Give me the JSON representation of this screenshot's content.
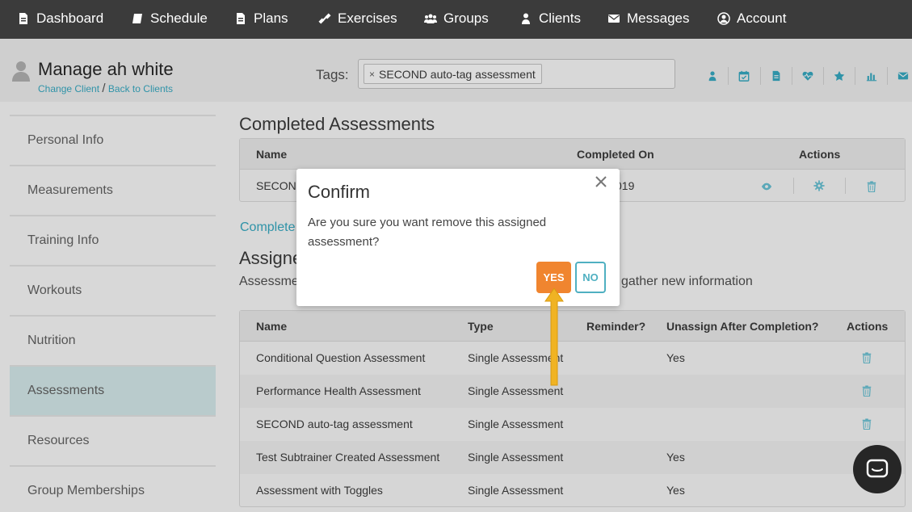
{
  "nav": [
    {
      "label": "Dashboard",
      "icon": "file-icon"
    },
    {
      "label": "Schedule",
      "icon": "book-icon"
    },
    {
      "label": "Plans",
      "icon": "document-icon"
    },
    {
      "label": "Exercises",
      "icon": "dumbbell-icon"
    },
    {
      "label": "Groups",
      "icon": "users-icon"
    },
    {
      "label": "Clients",
      "icon": "user-icon"
    },
    {
      "label": "Messages",
      "icon": "envelope-icon"
    },
    {
      "label": "Account",
      "icon": "account-circle-icon"
    }
  ],
  "header": {
    "title": "Manage ah white",
    "change_client": "Change Client",
    "separator": "/",
    "back_to_clients": "Back to Clients",
    "tags_label": "Tags:",
    "tags": [
      "SECOND auto-tag assessment"
    ],
    "quick_icons": [
      "user-icon",
      "calendar-icon",
      "document-icon",
      "heartbeat-icon",
      "star-icon",
      "bar-chart-icon",
      "envelope-icon"
    ]
  },
  "sidebar": {
    "items": [
      {
        "label": "Personal Info"
      },
      {
        "label": "Measurements"
      },
      {
        "label": "Training Info"
      },
      {
        "label": "Workouts"
      },
      {
        "label": "Nutrition"
      },
      {
        "label": "Assessments",
        "active": true
      },
      {
        "label": "Resources"
      },
      {
        "label": "Group Memberships"
      }
    ]
  },
  "completed": {
    "title": "Completed Assessments",
    "headers": {
      "name": "Name",
      "completed_on": "Completed On",
      "actions": "Actions"
    },
    "row": {
      "name": "SECOND",
      "completed_on": "019"
    },
    "complete_link": "Complete"
  },
  "assigned": {
    "title": "Assigne",
    "desc_left": "Assessme",
    "desc_right": "gather new information",
    "headers": {
      "name": "Name",
      "type": "Type",
      "reminder": "Reminder?",
      "unassign": "Unassign After Completion?",
      "actions": "Actions"
    },
    "rows": [
      {
        "name": "Conditional Question Assessment",
        "type": "Single Assessment",
        "reminder": "",
        "unassign": "Yes"
      },
      {
        "name": "Performance Health Assessment",
        "type": "Single Assessment",
        "reminder": "",
        "unassign": ""
      },
      {
        "name": "SECOND auto-tag assessment",
        "type": "Single Assessment",
        "reminder": "",
        "unassign": ""
      },
      {
        "name": "Test Subtrainer Created Assessment",
        "type": "Single Assessment",
        "reminder": "",
        "unassign": "Yes"
      },
      {
        "name": "Assessment with Toggles",
        "type": "Single Assessment",
        "reminder": "",
        "unassign": "Yes"
      }
    ]
  },
  "modal": {
    "title": "Confirm",
    "body": "Are you sure you want remove this assigned assessment?",
    "yes": "YES",
    "no": "NO"
  },
  "colors": {
    "nav_bg": "#3b3b3b",
    "accent": "#2f93a8",
    "yes_button": "#f0852f",
    "no_border": "#4fb0c1",
    "arrow": "#f0b323",
    "active_sidebar": "#b9cbcc"
  }
}
